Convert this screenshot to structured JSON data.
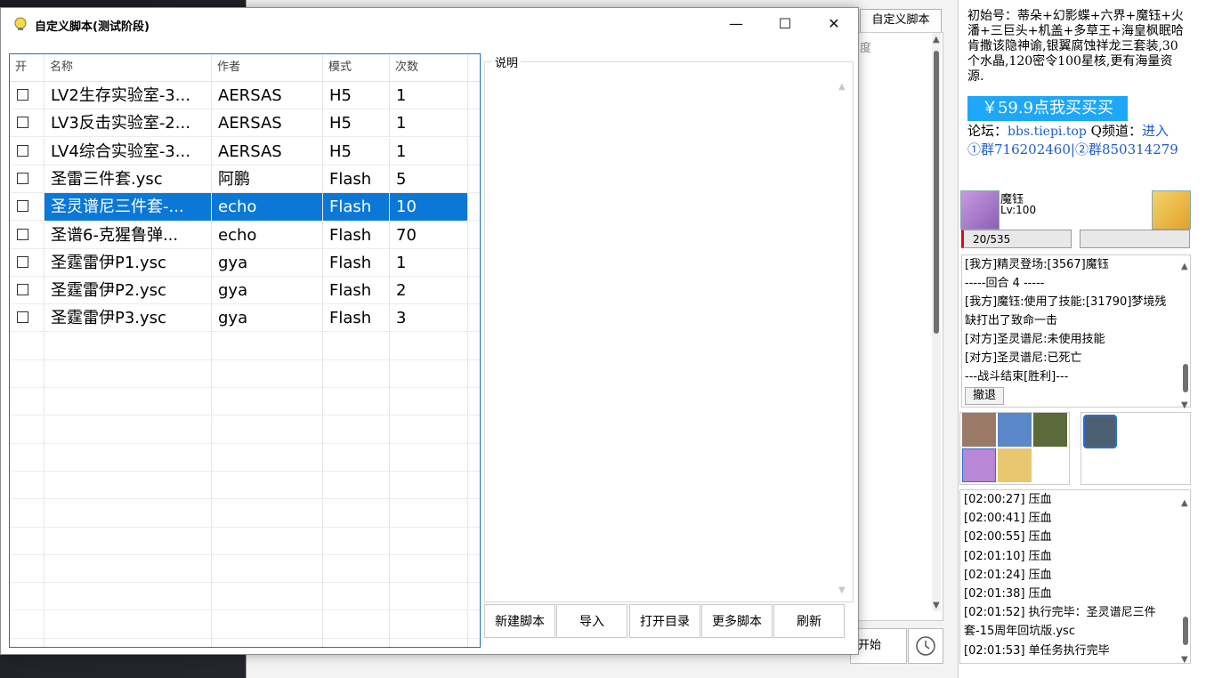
{
  "dialog": {
    "title": "自定义脚本(测试阶段)",
    "controls": {
      "minimize": "—",
      "maximize": "☐",
      "close": "✕"
    },
    "grid": {
      "columns": [
        "开",
        "名称",
        "作者",
        "模式",
        "次数"
      ],
      "rows": [
        {
          "name": "LV2生存实验室-3...",
          "author": "AERSAS",
          "mode": "H5",
          "count": "1",
          "checked": false,
          "selected": false
        },
        {
          "name": "LV3反击实验室-2...",
          "author": "AERSAS",
          "mode": "H5",
          "count": "1",
          "checked": false,
          "selected": false
        },
        {
          "name": "LV4综合实验室-3...",
          "author": "AERSAS",
          "mode": "H5",
          "count": "1",
          "checked": false,
          "selected": false
        },
        {
          "name": "圣雷三件套.ysc",
          "author": "阿鹏",
          "mode": "Flash",
          "count": "5",
          "checked": false,
          "selected": false
        },
        {
          "name": "圣灵谱尼三件套-...",
          "author": "echo",
          "mode": "Flash",
          "count": "10",
          "checked": false,
          "selected": true
        },
        {
          "name": "圣谱6-克猩鲁弹...",
          "author": "echo",
          "mode": "Flash",
          "count": "70",
          "checked": false,
          "selected": false
        },
        {
          "name": "圣霆雷伊P1.ysc",
          "author": "gya",
          "mode": "Flash",
          "count": "1",
          "checked": false,
          "selected": false
        },
        {
          "name": "圣霆雷伊P2.ysc",
          "author": "gya",
          "mode": "Flash",
          "count": "2",
          "checked": false,
          "selected": false
        },
        {
          "name": "圣霆雷伊P3.ysc",
          "author": "gya",
          "mode": "Flash",
          "count": "3",
          "checked": false,
          "selected": false
        }
      ]
    },
    "description_label": "说明",
    "buttons": [
      "新建脚本",
      "导入",
      "打开目录",
      "更多脚本",
      "刷新"
    ]
  },
  "main": {
    "tab_label": "自定义脚本",
    "partial_header": "度",
    "start_label": "开始",
    "ad": {
      "text": "初始号：蒂朵+幻影蝶+六界+魔钰+火潘+三巨头+机盖+多草王+海皇枫眠哈肯撒该隐神谕,银翼腐蚀祥龙三套装,30个水晶,120密令100星核,更有海量资源.",
      "buy_label": "￥59.9点我买买买",
      "forum_label": "论坛：",
      "forum_url": "bbs.tiepi.top",
      "channel_label": "Q频道：",
      "channel_link": "进入",
      "group1": "①群716202460|",
      "group2": "②群850314279"
    },
    "pet": {
      "name": "魔钰",
      "level": "Lv:100",
      "hp": "20/535"
    },
    "battle_log": [
      "[我方]精灵登场:[3567]魔钰",
      "-----回合 4 -----",
      "[我方]魔钰:使用了技能:[31790]梦境残缺打出了致命一击",
      "[对方]圣灵谱尼:未使用技能",
      "[对方]圣灵谱尼:已死亡",
      "---战斗结束[胜利]---"
    ],
    "revoke_label": "撤退",
    "sys_log": [
      "[02:00:27] 压血",
      "[02:00:41] 压血",
      "[02:00:55] 压血",
      "[02:01:10] 压血",
      "[02:01:24] 压血",
      "[02:01:38] 压血",
      "[02:01:52] 执行完毕：圣灵谱尼三件套-15周年回坑版.ysc",
      "[02:01:53] 单任务执行完毕"
    ],
    "colors": {
      "accent": "#0b78d7",
      "buy": "#1ea7f7",
      "link": "#1f5ccf"
    }
  }
}
